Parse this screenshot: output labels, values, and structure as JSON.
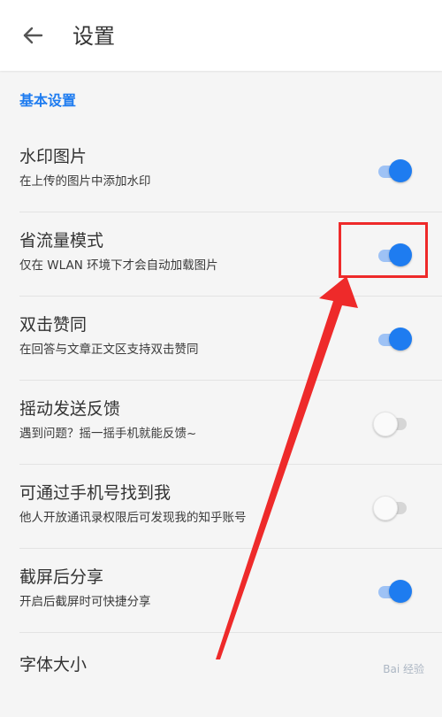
{
  "header": {
    "back_icon": "arrow-left-icon",
    "title": "设置"
  },
  "section": {
    "label": "基本设置",
    "color": "#1e7cf0"
  },
  "settings": [
    {
      "title": "水印图片",
      "subtitle": "在上传的图片中添加水印",
      "enabled": true
    },
    {
      "title": "省流量模式",
      "subtitle": "仅在 WLAN 环境下才会自动加载图片",
      "enabled": true
    },
    {
      "title": "双击赞同",
      "subtitle": "在回答与文章正文区支持双击赞同",
      "enabled": true
    },
    {
      "title": "摇动发送反馈",
      "subtitle": "遇到问题？摇一摇手机就能反馈~",
      "enabled": false
    },
    {
      "title": "可通过手机号找到我",
      "subtitle": "他人开放通讯录权限后可发现我的知乎账号",
      "enabled": false
    },
    {
      "title": "截屏后分享",
      "subtitle": "开启后截屏时可快捷分享",
      "enabled": true
    },
    {
      "title": "字体大小",
      "subtitle": ""
    }
  ],
  "annotation": {
    "color": "#ee2a2a",
    "highlighted_setting": "省流量模式"
  },
  "watermark": "Bai 经验"
}
